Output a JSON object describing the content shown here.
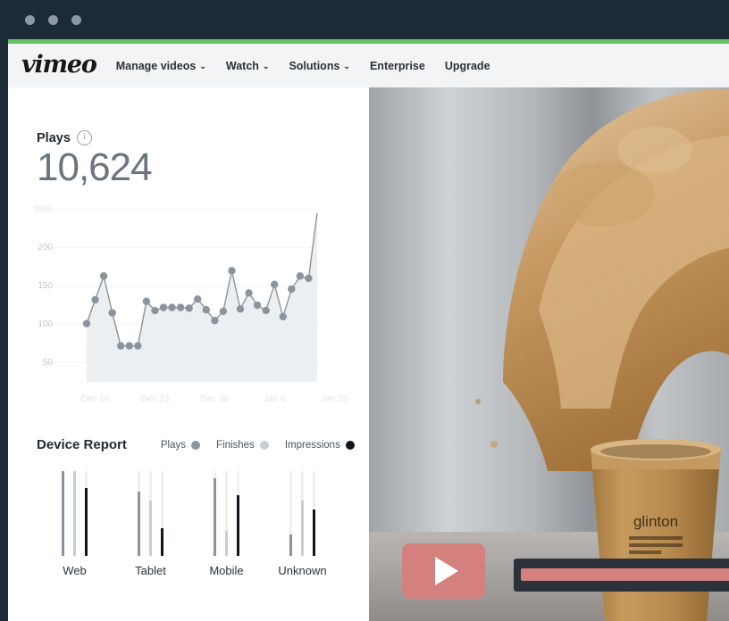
{
  "window": {
    "dots": [
      "close-dot",
      "minimize-dot",
      "maximize-dot"
    ],
    "accent_green": "#62c462",
    "chrome_color": "#1d2b39"
  },
  "nav": {
    "logo": "vimeo",
    "items": [
      {
        "label": "Manage videos",
        "caret": "⌄",
        "has_caret": true
      },
      {
        "label": "Watch",
        "caret": "⌄",
        "has_caret": true
      },
      {
        "label": "Solutions",
        "caret": "⌄",
        "has_caret": true
      },
      {
        "label": "Enterprise",
        "caret": "",
        "has_caret": false
      },
      {
        "label": "Upgrade",
        "caret": "",
        "has_caret": false
      }
    ]
  },
  "plays": {
    "label": "Plays",
    "info_icon": "info-icon",
    "value": "10,624"
  },
  "chart_data": {
    "type": "line",
    "title": "Plays",
    "xlabel": "",
    "ylabel": "",
    "grid": true,
    "legend_position": "none",
    "ylim": [
      25,
      260
    ],
    "yticks": [
      "888k",
      "200",
      "150",
      "100",
      "50"
    ],
    "ytick_values": [
      250,
      200,
      150,
      100,
      50
    ],
    "xticks": [
      "Dec 16",
      "Dec 23",
      "Dec 30",
      "Jan 6",
      "Jan 20"
    ],
    "xtick_values": [
      1,
      8,
      15,
      22,
      29
    ],
    "series": [
      {
        "name": "Plays",
        "color": "#8b949c",
        "fill": "#e9edf0",
        "values": [
          101,
          132,
          163,
          115,
          72,
          72,
          72,
          130,
          118,
          122,
          122,
          122,
          121,
          133,
          119,
          105,
          117,
          170,
          120,
          141,
          125,
          118,
          152,
          110,
          146,
          163,
          160,
          245
        ]
      }
    ]
  },
  "device_report": {
    "title": "Device Report",
    "legend": [
      {
        "label": "Plays",
        "color": "#8b949c"
      },
      {
        "label": "Finishes",
        "color": "#c9ced3"
      },
      {
        "label": "Impressions",
        "color": "#12161a"
      }
    ],
    "devices": [
      {
        "name": "Web",
        "plays": 100,
        "finishes": 100,
        "impressions": 80
      },
      {
        "name": "Tablet",
        "plays": 76,
        "finishes": 65,
        "impressions": 33
      },
      {
        "name": "Mobile",
        "plays": 92,
        "finishes": 30,
        "impressions": 72
      },
      {
        "name": "Unknown",
        "plays": 25,
        "finishes": 65,
        "impressions": 55
      }
    ]
  },
  "video": {
    "play_button": "play-button",
    "play_color": "#d4807e",
    "progress_percent": 96,
    "photo_alt": "coffee splash out of a paper cup"
  }
}
